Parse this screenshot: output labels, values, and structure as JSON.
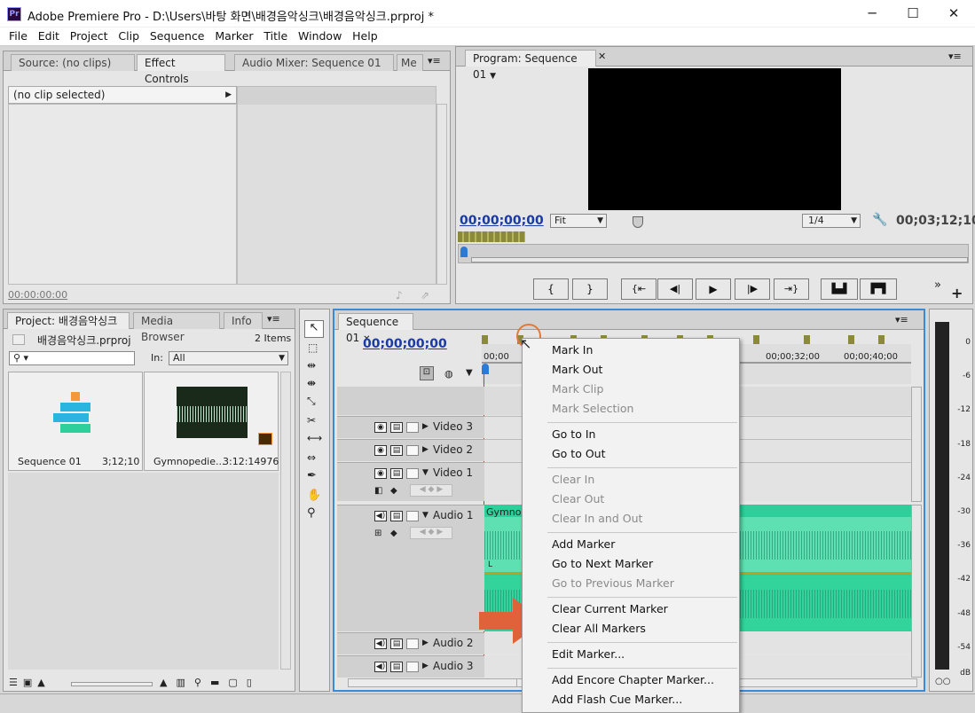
{
  "window": {
    "title": "Adobe Premiere Pro - D:\\Users\\바탕 화면\\배경음악싱크\\배경음악싱크.prproj *",
    "logo": "Pr",
    "minimize": "─",
    "maximize": "☐",
    "close": "✕"
  },
  "menubar": [
    "File",
    "Edit",
    "Project",
    "Clip",
    "Sequence",
    "Marker",
    "Title",
    "Window",
    "Help"
  ],
  "source_panel": {
    "tabs": [
      "Source: (no clips)",
      "Effect Controls",
      "Audio Mixer: Sequence 01",
      "Me"
    ],
    "no_clip": "(no clip selected)",
    "timecode": "00:00:00:00"
  },
  "program_panel": {
    "tab": "Program: Sequence 01",
    "timecode_left": "00;00;00;00",
    "fit": "Fit",
    "resolution": "1/4",
    "timecode_right": "00;03;12;10"
  },
  "project_panel": {
    "tabs": [
      "Project: 배경음악싱크",
      "Media Browser",
      "Info"
    ],
    "file": "배경음악싱크.prproj",
    "items_count": "2 Items",
    "in_label": "In:",
    "in_value": "All",
    "items": [
      {
        "name": "Sequence 01",
        "duration": "3;12;10"
      },
      {
        "name": "Gymnopedie...",
        "duration": "3:12:14976"
      }
    ]
  },
  "timeline": {
    "tab": "Sequence 01",
    "timecode": "00;00;00;00",
    "ruler": [
      "00;00",
      "00;00;32;00",
      "00;00;40;00"
    ],
    "tracks": [
      "Video 3",
      "Video 2",
      "Video 1",
      "Audio 1",
      "Audio 2",
      "Audio 3"
    ],
    "clip_name": "Gymnop",
    "channel_l": "L"
  },
  "context_menu": {
    "items": [
      {
        "label": "Mark In",
        "enabled": true
      },
      {
        "label": "Mark Out",
        "enabled": true
      },
      {
        "label": "Mark Clip",
        "enabled": false
      },
      {
        "label": "Mark Selection",
        "enabled": false
      },
      {
        "label": "Go to In",
        "enabled": true
      },
      {
        "label": "Go to Out",
        "enabled": true
      },
      {
        "label": "Clear In",
        "enabled": false
      },
      {
        "label": "Clear Out",
        "enabled": false
      },
      {
        "label": "Clear In and Out",
        "enabled": false
      },
      {
        "label": "Add Marker",
        "enabled": true
      },
      {
        "label": "Go to Next Marker",
        "enabled": true
      },
      {
        "label": "Go to Previous Marker",
        "enabled": false
      },
      {
        "label": "Clear Current Marker",
        "enabled": true
      },
      {
        "label": "Clear All Markers",
        "enabled": true
      },
      {
        "label": "Edit Marker...",
        "enabled": true
      },
      {
        "label": "Add Encore Chapter Marker...",
        "enabled": true
      },
      {
        "label": "Add Flash Cue Marker...",
        "enabled": true
      }
    ]
  },
  "audio_meter": {
    "labels": [
      "0",
      "-6",
      "-12",
      "-18",
      "-24",
      "-30",
      "-36",
      "-42",
      "-48",
      "-54",
      "dB"
    ]
  },
  "colors": {
    "accent_arrow": "#e0623a",
    "timecode_blue": "#1a3aa8",
    "audio_clip": "#2ecf9a"
  }
}
